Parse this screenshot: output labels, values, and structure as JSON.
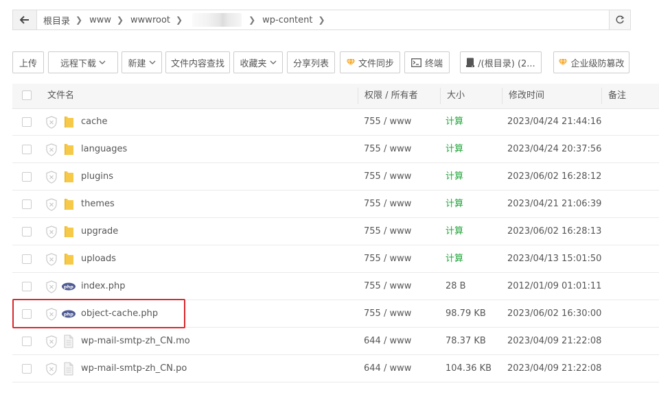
{
  "breadcrumb": {
    "items": [
      "根目录",
      "www",
      "wwwroot",
      "wp-content"
    ]
  },
  "toolbar": {
    "upload": "上传",
    "remote_download": "远程下载",
    "new": "新建",
    "content_search": "文件内容查找",
    "favorites": "收藏夹",
    "share_list": "分享列表",
    "file_sync": "文件同步",
    "terminal": "终端",
    "disk": "/(根目录) (2...",
    "tamper_protect": "企业级防篡改"
  },
  "table": {
    "headers": {
      "name": "文件名",
      "perm": "权限 / 所有者",
      "size": "大小",
      "mtime": "修改时间",
      "note": "备注"
    },
    "rows": [
      {
        "name": "cache",
        "type": "folder",
        "perm": "755 / www",
        "size": "计算",
        "mtime": "2023/04/24 21:44:16"
      },
      {
        "name": "languages",
        "type": "folder",
        "perm": "755 / www",
        "size": "计算",
        "mtime": "2023/04/24 20:37:56"
      },
      {
        "name": "plugins",
        "type": "folder",
        "perm": "755 / www",
        "size": "计算",
        "mtime": "2023/06/02 16:28:12"
      },
      {
        "name": "themes",
        "type": "folder",
        "perm": "755 / www",
        "size": "计算",
        "mtime": "2023/04/21 21:06:39"
      },
      {
        "name": "upgrade",
        "type": "folder",
        "perm": "755 / www",
        "size": "计算",
        "mtime": "2023/06/02 16:28:13"
      },
      {
        "name": "uploads",
        "type": "folder",
        "perm": "755 / www",
        "size": "计算",
        "mtime": "2023/04/13 15:01:50"
      },
      {
        "name": "index.php",
        "type": "php",
        "perm": "755 / www",
        "size": "28 B",
        "mtime": "2012/01/09 01:01:11"
      },
      {
        "name": "object-cache.php",
        "type": "php",
        "perm": "755 / www",
        "size": "98.79 KB",
        "mtime": "2023/06/02 16:30:00"
      },
      {
        "name": "wp-mail-smtp-zh_CN.mo",
        "type": "file",
        "perm": "644 / www",
        "size": "78.37 KB",
        "mtime": "2023/04/09 21:22:08"
      },
      {
        "name": "wp-mail-smtp-zh_CN.po",
        "type": "file",
        "perm": "644 / www",
        "size": "104.36 KB",
        "mtime": "2023/04/09 21:22:08"
      }
    ]
  },
  "colors": {
    "calc_green": "#20a53a",
    "folder_yellow": "#f7c948",
    "php_blue": "#4f5b93",
    "highlight_red": "#d9262a",
    "gem_orange": "#f5a623"
  },
  "icons": {
    "back": "arrow-left-icon",
    "refresh": "refresh-icon",
    "shield": "shield-x-icon",
    "folder": "folder-icon",
    "php": "php-icon",
    "file": "document-icon",
    "terminal": "terminal-icon",
    "disk": "disk-icon",
    "gem": "gem-icon"
  }
}
